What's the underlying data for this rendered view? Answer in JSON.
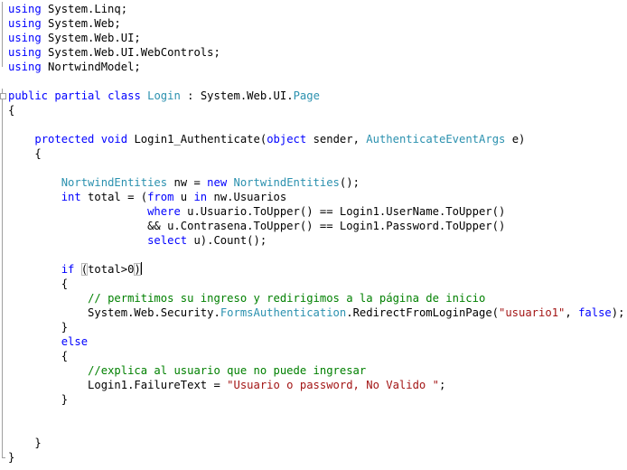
{
  "colors": {
    "keyword": "#0000ff",
    "type": "#2b91af",
    "comment": "#008000",
    "string": "#a31515",
    "text": "#000000",
    "background": "#ffffff"
  },
  "lines": [
    [
      [
        "kw",
        "using"
      ],
      [
        "pl",
        " System.Linq;"
      ]
    ],
    [
      [
        "kw",
        "using"
      ],
      [
        "pl",
        " System.Web;"
      ]
    ],
    [
      [
        "kw",
        "using"
      ],
      [
        "pl",
        " System.Web.UI;"
      ]
    ],
    [
      [
        "kw",
        "using"
      ],
      [
        "pl",
        " System.Web.UI.WebControls;"
      ]
    ],
    [
      [
        "kw",
        "using"
      ],
      [
        "pl",
        " NortwindModel;"
      ]
    ],
    [],
    [
      [
        "kw",
        "public"
      ],
      [
        "pl",
        " "
      ],
      [
        "kw",
        "partial"
      ],
      [
        "pl",
        " "
      ],
      [
        "kw",
        "class"
      ],
      [
        "pl",
        " "
      ],
      [
        "ty",
        "Login"
      ],
      [
        "pl",
        " : System.Web.UI."
      ],
      [
        "ty",
        "Page"
      ]
    ],
    [
      [
        "pl",
        "{"
      ]
    ],
    [],
    [
      [
        "pl",
        "    "
      ],
      [
        "kw",
        "protected"
      ],
      [
        "pl",
        " "
      ],
      [
        "kw",
        "void"
      ],
      [
        "pl",
        " Login1_Authenticate("
      ],
      [
        "kw",
        "object"
      ],
      [
        "pl",
        " sender, "
      ],
      [
        "ty",
        "AuthenticateEventArgs"
      ],
      [
        "pl",
        " e)"
      ]
    ],
    [
      [
        "pl",
        "    {"
      ]
    ],
    [],
    [
      [
        "pl",
        "        "
      ],
      [
        "ty",
        "NortwindEntities"
      ],
      [
        "pl",
        " nw = "
      ],
      [
        "kw",
        "new"
      ],
      [
        "pl",
        " "
      ],
      [
        "ty",
        "NortwindEntities"
      ],
      [
        "pl",
        "();"
      ]
    ],
    [
      [
        "pl",
        "        "
      ],
      [
        "kw",
        "int"
      ],
      [
        "pl",
        " total = ("
      ],
      [
        "kw",
        "from"
      ],
      [
        "pl",
        " u "
      ],
      [
        "kw",
        "in"
      ],
      [
        "pl",
        " nw.Usuarios"
      ]
    ],
    [
      [
        "pl",
        "                     "
      ],
      [
        "kw",
        "where"
      ],
      [
        "pl",
        " u.Usuario.ToUpper() == Login1.UserName.ToUpper()"
      ]
    ],
    [
      [
        "pl",
        "                     && u.Contrasena.ToUpper() == Login1.Password.ToUpper()"
      ]
    ],
    [
      [
        "pl",
        "                     "
      ],
      [
        "kw",
        "select"
      ],
      [
        "pl",
        " u).Count();"
      ]
    ],
    [],
    [
      [
        "pl",
        "        "
      ],
      [
        "kw",
        "if"
      ],
      [
        "pl",
        " "
      ],
      [
        "bm",
        "("
      ],
      [
        "pl",
        "total>0"
      ],
      [
        "bm",
        ")"
      ],
      [
        "caret",
        ""
      ]
    ],
    [
      [
        "pl",
        "        {"
      ]
    ],
    [
      [
        "pl",
        "            "
      ],
      [
        "cm",
        "// permitimos su ingreso y redirigimos a la página de inicio"
      ]
    ],
    [
      [
        "pl",
        "            System.Web.Security."
      ],
      [
        "ty",
        "FormsAuthentication"
      ],
      [
        "pl",
        ".RedirectFromLoginPage("
      ],
      [
        "st",
        "\"usuario1\""
      ],
      [
        "pl",
        ", "
      ],
      [
        "kw",
        "false"
      ],
      [
        "pl",
        ");"
      ]
    ],
    [
      [
        "pl",
        "        }"
      ]
    ],
    [
      [
        "pl",
        "        "
      ],
      [
        "kw",
        "else"
      ]
    ],
    [
      [
        "pl",
        "        {"
      ]
    ],
    [
      [
        "pl",
        "            "
      ],
      [
        "cm",
        "//explica al usuario que no puede ingresar"
      ]
    ],
    [
      [
        "pl",
        "            Login1.FailureText = "
      ],
      [
        "st",
        "\"Usuario o password, No Valido \""
      ],
      [
        "pl",
        ";"
      ]
    ],
    [
      [
        "pl",
        "        }"
      ]
    ],
    [],
    [],
    [
      [
        "pl",
        "    }"
      ]
    ],
    [
      [
        "pl",
        "}"
      ]
    ]
  ]
}
